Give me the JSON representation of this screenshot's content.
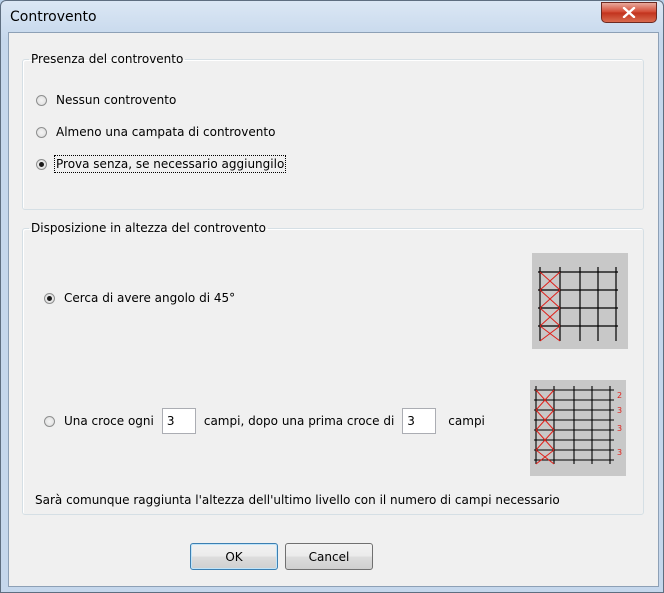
{
  "window": {
    "title": "Controvento"
  },
  "presence": {
    "legend": "Presenza del controvento",
    "options": [
      {
        "label": "Nessun controvento",
        "checked": false
      },
      {
        "label": "Almeno una campata di controvento",
        "checked": false
      },
      {
        "label": "Prova senza, se necessario aggiungilo",
        "checked": true
      }
    ]
  },
  "height": {
    "legend": "Disposizione in altezza del controvento",
    "option_angle": {
      "label": "Cerca di avere angolo di 45°",
      "checked": true
    },
    "option_cross": {
      "label_before": "Una croce ogni",
      "every_value": "3",
      "label_middle": "campi, dopo una prima croce di",
      "first_value": "3",
      "label_after": "campi",
      "checked": false
    },
    "diagram_labels": [
      "2",
      "3",
      "3",
      "3"
    ],
    "note": "Sarà comunque raggiunta l'altezza dell'ultimo livello con il numero di campi necessario"
  },
  "buttons": {
    "ok": "OK",
    "cancel": "Cancel"
  },
  "colors": {
    "brace": "#e0201a",
    "diagram_bg": "#c8c8c8"
  }
}
